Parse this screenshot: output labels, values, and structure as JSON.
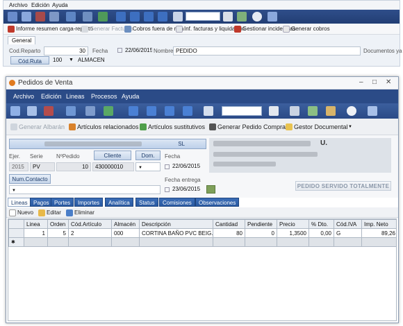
{
  "colors": {
    "toolbar_dark": "#2a4a86",
    "accent_tab": "#2a5aa2",
    "window_bg": "#ffffff"
  },
  "bg_window": {
    "menu": [
      "Archivo",
      "Edición",
      "Ayuda"
    ],
    "toolbar_icons": [
      "new-icon",
      "save-icon",
      "delete-icon",
      "save-close-icon",
      "refresh-icon",
      "cut-icon",
      "filter-icon",
      "first-icon",
      "prev-icon",
      "next-icon",
      "last-icon",
      "mail-icon",
      "search-icon",
      "users-icon",
      "help-icon",
      "exit-icon"
    ],
    "actions": [
      {
        "label": "Informe resumen carga-reparto",
        "icon": "report-icon",
        "disabled": false
      },
      {
        "label": "Generar Facturas",
        "icon": "invoice-icon",
        "disabled": true
      },
      {
        "label": "Cobros fuera de ruta",
        "icon": "payments-icon",
        "disabled": false
      },
      {
        "label": "Inf. facturas y liquidación",
        "icon": "document-icon",
        "disabled": false
      },
      {
        "label": "Gestionar incidencias",
        "icon": "incident-icon",
        "disabled": false
      },
      {
        "label": "Generar cobros",
        "icon": "cash-icon",
        "disabled": false
      }
    ],
    "tab": "General",
    "cod_reparto_label": "Cod.Reparto",
    "cod_reparto_value": "30",
    "fecha_label": "Fecha",
    "fecha_value": "22/06/2015",
    "nombre_label": "Nombre",
    "nombre_value": "PEDIDO",
    "docs_label": "Documentos ya ger",
    "cod_ruta_label": "Cód.Ruta",
    "cod_ruta_value": "100",
    "ruta_name": "ALMACEN"
  },
  "window": {
    "title": "Pedidos de Venta",
    "controls": [
      "–",
      "□",
      "✕"
    ],
    "menu": [
      "Archivo",
      "Edición",
      "Lineas",
      "Procesos",
      "Ayuda"
    ],
    "toolbar_icons": [
      "new-icon",
      "save-icon",
      "delete-icon",
      "refresh-icon",
      "cut-icon",
      "filter-icon",
      "first-icon",
      "prev-icon",
      "next-icon",
      "last-icon",
      "mail-icon",
      "search-icon",
      "print-icon",
      "users-icon",
      "export-icon",
      "help-icon",
      "exit-icon"
    ],
    "actions": {
      "generar_albaran": "Generar Albarán",
      "relacionados": "Artículos relacionados",
      "sustitutivos": "Artículos sustitutivos",
      "pedido_compra": "Generar Pedido Compra",
      "gestor": "Gestor Documental"
    },
    "header": {
      "company_suffix": "SL",
      "ejer_label": "Ejer.",
      "ejer_value": "2015",
      "serie_label": "Serie",
      "serie_value": "PV",
      "npedido_label": "NºPedido",
      "npedido_value": "10",
      "cliente_button": "Cliente",
      "cliente_value": "430000010",
      "dom_button": "Dom.",
      "fecha_label": "Fecha",
      "fecha_value": "22/06/2015",
      "num_contacto_button": "Num.Contacto",
      "fecha_entrega_label": "Fecha entrega",
      "fecha_entrega_value": "23/06/2015",
      "customer_letter": "U.",
      "pedido_servido_button": "PEDIDO SERVIDO TOTALMENTE"
    },
    "tabs": [
      "Lineas",
      "Pagos",
      "Portes",
      "Importes",
      "Analítica",
      "Status",
      "Comisiones",
      "Observaciones"
    ],
    "subtoolbar": {
      "nuevo": "Nuevo",
      "editar": "Editar",
      "eliminar": "Eliminar"
    },
    "grid": {
      "columns": [
        "Linea",
        "Orden",
        "Cód.Artículo",
        "Almacén",
        "Descripción",
        "Cantidad",
        "Pendiente",
        "Precio",
        "% Dto.",
        "Cód.IVA",
        "Imp. Neto"
      ],
      "rows": [
        [
          "1",
          "5",
          "2",
          "000",
          "CORTINA BAÑO PVC BEIG...",
          "80",
          "0",
          "1,3500",
          "0,00",
          "G",
          "89,26"
        ]
      ],
      "new_row_marker": "✱"
    }
  }
}
